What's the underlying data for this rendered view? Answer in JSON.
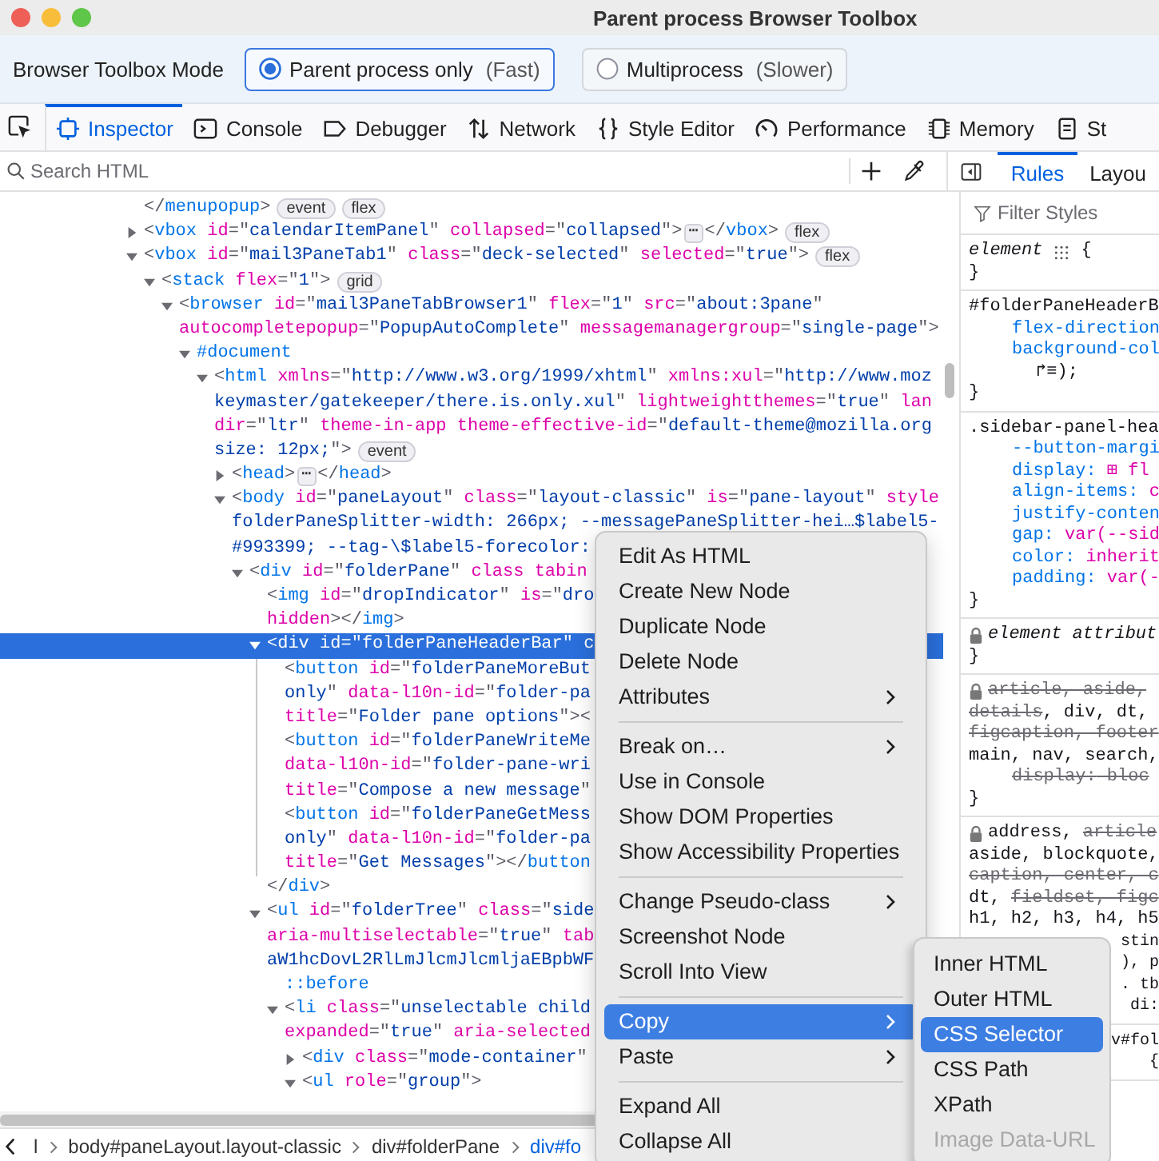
{
  "window": {
    "title": "Parent process Browser Toolbox"
  },
  "mode_bar": {
    "label": "Browser Toolbox Mode",
    "options": [
      {
        "label": "Parent process only",
        "note": "(Fast)",
        "selected": true
      },
      {
        "label": "Multiprocess",
        "note": "(Slower)",
        "selected": false
      }
    ]
  },
  "tabs": [
    {
      "kind": "inspector",
      "label": "Inspector",
      "selected": true
    },
    {
      "kind": "console",
      "label": "Console",
      "selected": false
    },
    {
      "kind": "debugger",
      "label": "Debugger",
      "selected": false
    },
    {
      "kind": "network",
      "label": "Network",
      "selected": false
    },
    {
      "kind": "style",
      "label": "Style Editor",
      "selected": false
    },
    {
      "kind": "performance",
      "label": "Performance",
      "selected": false
    },
    {
      "kind": "memory",
      "label": "Memory",
      "selected": false
    },
    {
      "kind": "storage",
      "label": "St",
      "selected": false
    }
  ],
  "search": {
    "placeholder": "Search HTML"
  },
  "sidebar_tabs": [
    {
      "label": "Rules",
      "selected": true
    },
    {
      "label": "Layou",
      "selected": false
    }
  ],
  "markup_tree": [
    {
      "lines": [
        {
          "text": "</menupopup>",
          "in_value": false
        }
      ],
      "selected": false,
      "badges": [
        "event",
        "flex"
      ]
    },
    {
      "lines": [
        {
          "text": "<vbox id=\"calendarItemPanel\" collapsed=\"collapsed\">",
          "in_value": false
        }
      ],
      "expanded": false,
      "selected": false,
      "fold": {
        "mark": "⋯",
        "close": "</vbox>"
      },
      "badges": [
        "flex"
      ]
    },
    {
      "lines": [
        {
          "text": "<vbox id=\"mail3PaneTab1\" class=\"deck-selected\" selected=\"true\">",
          "in_value": false
        }
      ],
      "expanded": true,
      "selected": false,
      "badges": [
        "flex"
      ],
      "children": [
        {
          "lines": [
            {
              "text": "<stack flex=\"1\">",
              "in_value": false
            }
          ],
          "expanded": true,
          "selected": false,
          "badges": [
            "grid"
          ],
          "children": [
            {
              "lines": [
                {
                  "text": "<browser id=\"mail3PaneTabBrowser1\" flex=\"1\" src=\"about:3pane\"",
                  "in_value": false
                },
                {
                  "text": "autocompletepopup=\"PopupAutoComplete\" messagemanagergroup=\"single-page\">",
                  "in_value": false
                }
              ],
              "expanded": true,
              "selected": false,
              "children": [
                {
                  "lines": [
                    {
                      "text": "#document",
                      "in_value": false
                    }
                  ],
                  "expanded": true,
                  "selected": false,
                  "children": [
                    {
                      "lines": [
                        {
                          "text": "<html xmlns=\"http://www.w3.org/1999/xhtml\" xmlns:xul=\"http://www.moz",
                          "in_value": false
                        },
                        {
                          "text": "keymaster/gatekeeper/there.is.only.xul\" lightweightthemes=\"true\" lan",
                          "in_value": true
                        },
                        {
                          "text": "dir=\"ltr\" theme-in-app theme-effective-id=\"default-theme@mozilla.org",
                          "in_value": false
                        },
                        {
                          "text": "size: 12px;\">",
                          "in_value": true
                        }
                      ],
                      "expanded": true,
                      "selected": false,
                      "badges": [
                        "event"
                      ],
                      "children": [
                        {
                          "lines": [
                            {
                              "text": "<head>",
                              "in_value": false
                            }
                          ],
                          "expanded": false,
                          "selected": false,
                          "fold": {
                            "mark": "⋯",
                            "close": "</head>"
                          }
                        },
                        {
                          "lines": [
                            {
                              "text": "<body id=\"paneLayout\" class=\"layout-classic\" is=\"pane-layout\" style",
                              "in_value": false
                            },
                            {
                              "text": "folderPaneSplitter-width: 266px; --messagePaneSplitter-hei…$label5-",
                              "in_value": true
                            },
                            {
                              "text": "#993399; --tag-\\$label5-forecolor:",
                              "in_value": true
                            }
                          ],
                          "expanded": true,
                          "selected": false,
                          "children": [
                            {
                              "lines": [
                                {
                                  "text": "<div id=\"folderPane\" class tabin",
                                  "in_value": false
                                }
                              ],
                              "expanded": true,
                              "selected": false,
                              "children": [
                                {
                                  "lines": [
                                    {
                                      "text": "<img id=\"dropIndicator\" is=\"dro",
                                      "in_value": false
                                    },
                                    {
                                      "text": "hidden></img>",
                                      "in_value": false
                                    }
                                  ],
                                  "selected": false
                                },
                                {
                                  "lines": [
                                    {
                                      "text": "<div id=\"folderPaneHeaderBar\" c",
                                      "in_value": false
                                    }
                                  ],
                                  "expanded": true,
                                  "selected": true,
                                  "closing": "</div>",
                                  "children": [
                                    {
                                      "lines": [
                                        {
                                          "text": "<button id=\"folderPaneMoreBut",
                                          "in_value": false
                                        },
                                        {
                                          "text": "only\" data-l10n-id=\"folder-pa",
                                          "in_value": true
                                        },
                                        {
                                          "text": "title=\"Folder pane options\"><",
                                          "in_value": false
                                        }
                                      ],
                                      "selected": false
                                    },
                                    {
                                      "lines": [
                                        {
                                          "text": "<button id=\"folderPaneWriteMe",
                                          "in_value": false
                                        },
                                        {
                                          "text": "data-l10n-id=\"folder-pane-wri",
                                          "in_value": false
                                        },
                                        {
                                          "text": "title=\"Compose a new message\"",
                                          "in_value": false
                                        }
                                      ],
                                      "selected": false
                                    },
                                    {
                                      "lines": [
                                        {
                                          "text": "<button id=\"folderPaneGetMess",
                                          "in_value": false
                                        },
                                        {
                                          "text": "only\" data-l10n-id=\"folder-pa",
                                          "in_value": true
                                        },
                                        {
                                          "text": "title=\"Get Messages\"></button",
                                          "in_value": false
                                        }
                                      ],
                                      "selected": false
                                    }
                                  ]
                                },
                                {
                                  "lines": [
                                    {
                                      "text": "<ul id=\"folderTree\" class=\"side",
                                      "in_value": false
                                    },
                                    {
                                      "text": "aria-multiselectable=\"true\" tab",
                                      "in_value": false
                                    },
                                    {
                                      "text": "aW1hcDovL2RlLmJlcmJlcmljaEBpbWF",
                                      "in_value": true
                                    }
                                  ],
                                  "expanded": true,
                                  "selected": false,
                                  "children": [
                                    {
                                      "lines": [
                                        {
                                          "text": "::before",
                                          "in_value": false
                                        }
                                      ],
                                      "selected": false
                                    },
                                    {
                                      "lines": [
                                        {
                                          "text": "<li class=\"unselectable child",
                                          "in_value": false
                                        },
                                        {
                                          "text": "expanded=\"true\" aria-selected",
                                          "in_value": false
                                        }
                                      ],
                                      "expanded": true,
                                      "selected": false,
                                      "children": [
                                        {
                                          "lines": [
                                            {
                                              "text": "<div class=\"mode-container\"",
                                              "in_value": false
                                            }
                                          ],
                                          "expanded": false,
                                          "selected": false
                                        },
                                        {
                                          "lines": [
                                            {
                                              "text": "<ul role=\"group\">",
                                              "in_value": false
                                            }
                                          ],
                                          "expanded": true,
                                          "selected": false
                                        }
                                      ]
                                    }
                                  ]
                                }
                              ]
                            }
                          ]
                        }
                      ]
                    }
                  ]
                }
              ]
            }
          ]
        }
      ]
    }
  ],
  "breadcrumbs": [
    {
      "label": "l",
      "selected": false
    },
    {
      "label": "body#paneLayout.layout-classic",
      "selected": false
    },
    {
      "label": "div#folderPane",
      "selected": false
    },
    {
      "label": "div#fo",
      "selected": true
    }
  ],
  "rules": {
    "filter_placeholder": "Filter Styles",
    "blocks": [
      {
        "locked": false,
        "lines": [
          {
            "kind": "element",
            "text": "element",
            "brace": "{"
          },
          {
            "kind": "close",
            "text": "}"
          }
        ]
      },
      {
        "locked": false,
        "lines": [
          {
            "kind": "selector",
            "text": "#folderPaneHeaderB",
            "struck": false
          },
          {
            "kind": "decl",
            "text": "flex-direction",
            "struck": false
          },
          {
            "kind": "decl",
            "text": "background-col",
            "struck": false
          },
          {
            "kind": "cont",
            "text": "↱≡);"
          },
          {
            "kind": "close",
            "text": "}"
          }
        ]
      },
      {
        "locked": false,
        "lines": [
          {
            "kind": "selector",
            "text": ".sidebar-panel-hea",
            "struck": false
          },
          {
            "kind": "decl",
            "text": "--button-margi",
            "struck": false
          },
          {
            "kind": "decl",
            "text": "display: ⊞ fl",
            "struck": false
          },
          {
            "kind": "decl",
            "text": "align-items: c",
            "struck": false
          },
          {
            "kind": "decl",
            "text": "justify-conten",
            "struck": false
          },
          {
            "kind": "decl",
            "text": "gap: var(--sid",
            "struck": false
          },
          {
            "kind": "decl",
            "text": "color: inherit",
            "struck": false
          },
          {
            "kind": "decl",
            "text": "padding: var(-",
            "struck": false
          },
          {
            "kind": "close",
            "text": "}"
          }
        ]
      },
      {
        "locked": true,
        "lines": [
          {
            "kind": "italic",
            "text": "element attribut"
          },
          {
            "kind": "close",
            "text": "}"
          }
        ]
      },
      {
        "locked": true,
        "lines": [
          {
            "kind": "selector",
            "text": "article, aside,",
            "struck": true
          },
          {
            "kind": "selector",
            "parts": [
              {
                "text": "details",
                "struck": true
              },
              {
                "text": ", div, dt,",
                "struck": false
              }
            ]
          },
          {
            "kind": "selector",
            "text": "figcaption, footer",
            "struck": true
          },
          {
            "kind": "selector",
            "text": "main, nav, search,",
            "struck": false
          },
          {
            "kind": "decl",
            "text": "display: bloc",
            "struck": true
          },
          {
            "kind": "close",
            "text": "}"
          }
        ]
      },
      {
        "locked": true,
        "lines": [
          {
            "kind": "selector",
            "parts": [
              {
                "text": "address, ",
                "struck": false
              },
              {
                "text": "article",
                "struck": true
              }
            ]
          },
          {
            "kind": "selector",
            "text": "aside, blockquote,",
            "struck": false
          },
          {
            "kind": "selector",
            "text": "caption, center, c",
            "struck": true
          },
          {
            "kind": "selector",
            "parts": [
              {
                "text": "dt, ",
                "struck": false
              },
              {
                "text": "fieldset, figc",
                "struck": true
              }
            ]
          },
          {
            "kind": "selector",
            "text": "h1, h2, h3, h4, h5",
            "struck": false
          },
          {
            "kind": "tail",
            "text": "stin"
          },
          {
            "kind": "tail",
            "text": "), p"
          },
          {
            "kind": "tail",
            "text": ". tb"
          },
          {
            "kind": "tail",
            "text": "di:"
          }
        ]
      },
      {
        "lines": [
          {
            "kind": "tail",
            "text": "v#fol"
          },
          {
            "kind": "tail",
            "text": "{"
          }
        ]
      }
    ]
  },
  "context_menu": [
    {
      "kind": "item",
      "label": "Edit As HTML",
      "submenu": false,
      "selected": false
    },
    {
      "kind": "item",
      "label": "Create New Node",
      "submenu": false,
      "selected": false
    },
    {
      "kind": "item",
      "label": "Duplicate Node",
      "submenu": false,
      "selected": false
    },
    {
      "kind": "item",
      "label": "Delete Node",
      "submenu": false,
      "selected": false
    },
    {
      "kind": "item",
      "label": "Attributes",
      "submenu": true,
      "selected": false
    },
    {
      "kind": "separator"
    },
    {
      "kind": "item",
      "label": "Break on…",
      "submenu": true,
      "selected": false
    },
    {
      "kind": "item",
      "label": "Use in Console",
      "submenu": false,
      "selected": false
    },
    {
      "kind": "item",
      "label": "Show DOM Properties",
      "submenu": false,
      "selected": false
    },
    {
      "kind": "item",
      "label": "Show Accessibility Properties",
      "submenu": false,
      "selected": false
    },
    {
      "kind": "separator"
    },
    {
      "kind": "item",
      "label": "Change Pseudo-class",
      "submenu": true,
      "selected": false
    },
    {
      "kind": "item",
      "label": "Screenshot Node",
      "submenu": false,
      "selected": false
    },
    {
      "kind": "item",
      "label": "Scroll Into View",
      "submenu": false,
      "selected": false
    },
    {
      "kind": "separator"
    },
    {
      "kind": "item",
      "label": "Copy",
      "submenu": true,
      "selected": true
    },
    {
      "kind": "item",
      "label": "Paste",
      "submenu": true,
      "selected": false
    },
    {
      "kind": "separator"
    },
    {
      "kind": "item",
      "label": "Expand All",
      "submenu": false,
      "selected": false
    },
    {
      "kind": "item",
      "label": "Collapse All",
      "submenu": false,
      "selected": false
    }
  ],
  "copy_submenu": [
    {
      "label": "Inner HTML",
      "selected": false,
      "disabled": false
    },
    {
      "label": "Outer HTML",
      "selected": false,
      "disabled": false
    },
    {
      "label": "CSS Selector",
      "selected": true,
      "disabled": false
    },
    {
      "label": "CSS Path",
      "selected": false,
      "disabled": false
    },
    {
      "label": "XPath",
      "selected": false,
      "disabled": false
    },
    {
      "label": "Image Data-URL",
      "selected": false,
      "disabled": true
    }
  ]
}
